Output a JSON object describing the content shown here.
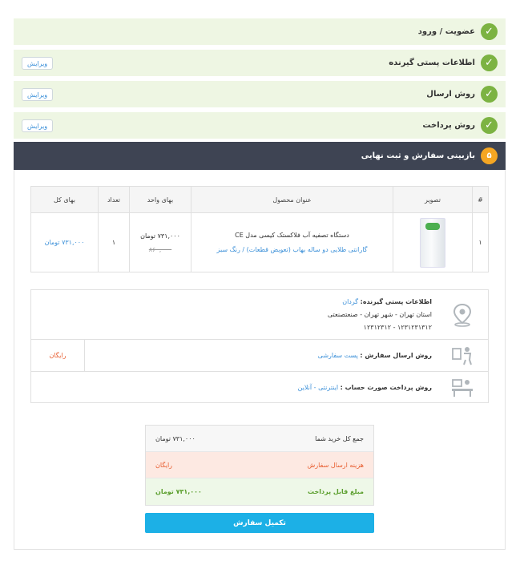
{
  "steps": [
    {
      "title": "عضویت / ورود",
      "edit": ""
    },
    {
      "title": "اطلاعات پستی گیرنده",
      "edit": "ویرایش"
    },
    {
      "title": "روش ارسال",
      "edit": "ویرایش"
    },
    {
      "title": "روش پرداخت",
      "edit": "ویرایش"
    }
  ],
  "review": {
    "number": "۵",
    "title": "بازبینی سفارش و ثبت نهایی"
  },
  "table": {
    "headers": [
      "#",
      "تصویر",
      "عنوان محصول",
      "بهای واحد",
      "تعداد",
      "بهای کل"
    ],
    "row": {
      "index": "۱",
      "name": "دستگاه تصفیه آب فلاکستک کیسی مدل CE",
      "options": "گارانتی طلایی دو ساله بهاب (تعویض قطعات)  /  رنگ سبز",
      "price": "۷۳۱,۰۰۰ تومان",
      "old_price": "۸۶۰,۰۰۰",
      "qty": "۱",
      "total": "۷۳۱,۰۰۰ تومان"
    }
  },
  "info": {
    "address_label": "اطلاعات پستی گیرنده:",
    "recipient": "گردان",
    "address": "استان تهران - شهر تهران - صنعتصنعتی",
    "phones": "۱۲۳۱۲۳۱۳۱۲ - ۱۲۳۱۲۳۱۲",
    "shipping_label": "روش ارسال سفارش :",
    "shipping_value": "پست سفارشی",
    "shipping_cost": "رایگان",
    "payment_label": "روش پرداخت صورت حساب :",
    "payment_value": "اینترنتی - آنلاین"
  },
  "summary": [
    {
      "label": "جمع کل خرید شما",
      "value": "۷۳۱,۰۰۰ تومان"
    },
    {
      "label": "هزینه ارسال سفارش",
      "value": "رایگان"
    },
    {
      "label": "مبلغ قابل پرداخت",
      "value": "۷۳۱,۰۰۰ تومان"
    }
  ],
  "submit_label": "تکمیل سفارش",
  "colors": {
    "success": "#7cb342",
    "step_bg": "#eef6e3",
    "header_dark": "#3e4453",
    "accent": "#1cb0e6",
    "warning": "#f5a623",
    "link": "#3a8fd8",
    "danger": "#e85d2f"
  }
}
